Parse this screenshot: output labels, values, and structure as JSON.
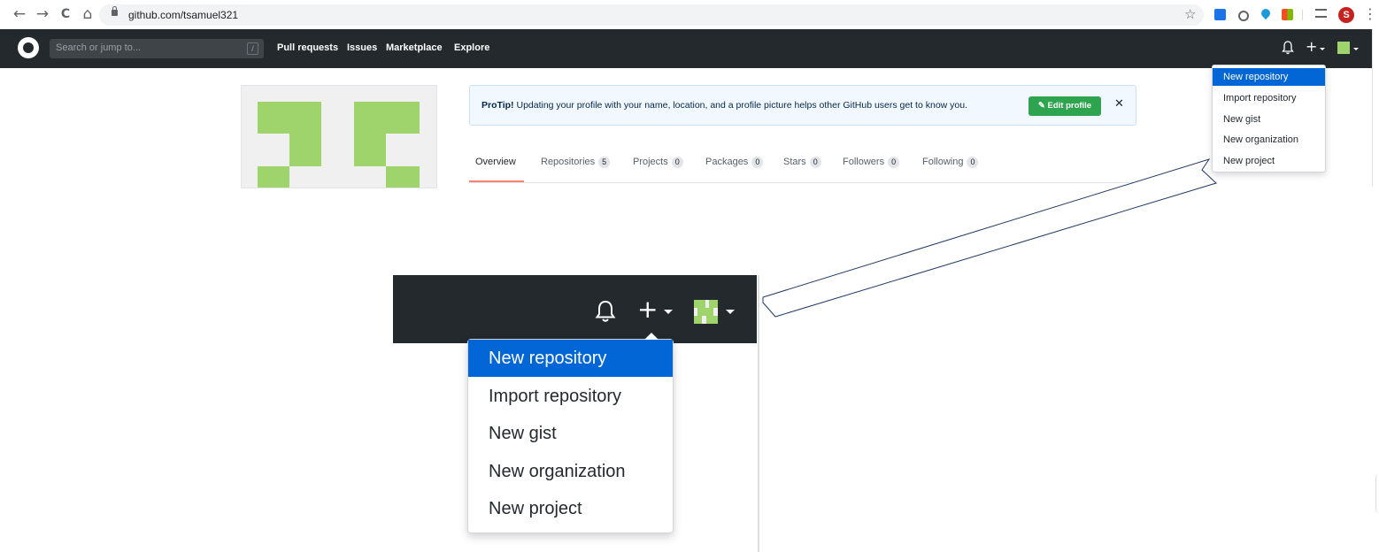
{
  "browser": {
    "url": "github.com/tsamuel321",
    "back_icon": "←",
    "forward_icon": "→",
    "reload_icon": "C",
    "home_icon": "⌂",
    "star_icon": "☆",
    "profile_initial": "S",
    "menu_icon": "⋮"
  },
  "header": {
    "search_placeholder": "Search or jump to...",
    "search_shortcut": "/",
    "nav": [
      "Pull requests",
      "Issues",
      "Marketplace",
      "Explore"
    ],
    "plus_icon": "+"
  },
  "protip": {
    "label": "ProTip!",
    "text": " Updating your profile with your name, location, and a profile picture helps other GitHub users get to know you.",
    "button": "Edit profile",
    "close_icon": "✕"
  },
  "tabs": [
    {
      "label": "Overview",
      "count": null
    },
    {
      "label": "Repositories",
      "count": "5"
    },
    {
      "label": "Projects",
      "count": "0"
    },
    {
      "label": "Packages",
      "count": "0"
    },
    {
      "label": "Stars",
      "count": "0"
    },
    {
      "label": "Followers",
      "count": "0"
    },
    {
      "label": "Following",
      "count": "0"
    }
  ],
  "dropdown": {
    "items": [
      "New repository",
      "Import repository",
      "New gist",
      "New organization",
      "New project"
    ],
    "active_index": 0
  },
  "colors": {
    "header_bg": "#24292e",
    "accent_blue": "#0366d6",
    "button_green": "#2ea44f",
    "avatar_green": "#9fd36b"
  }
}
